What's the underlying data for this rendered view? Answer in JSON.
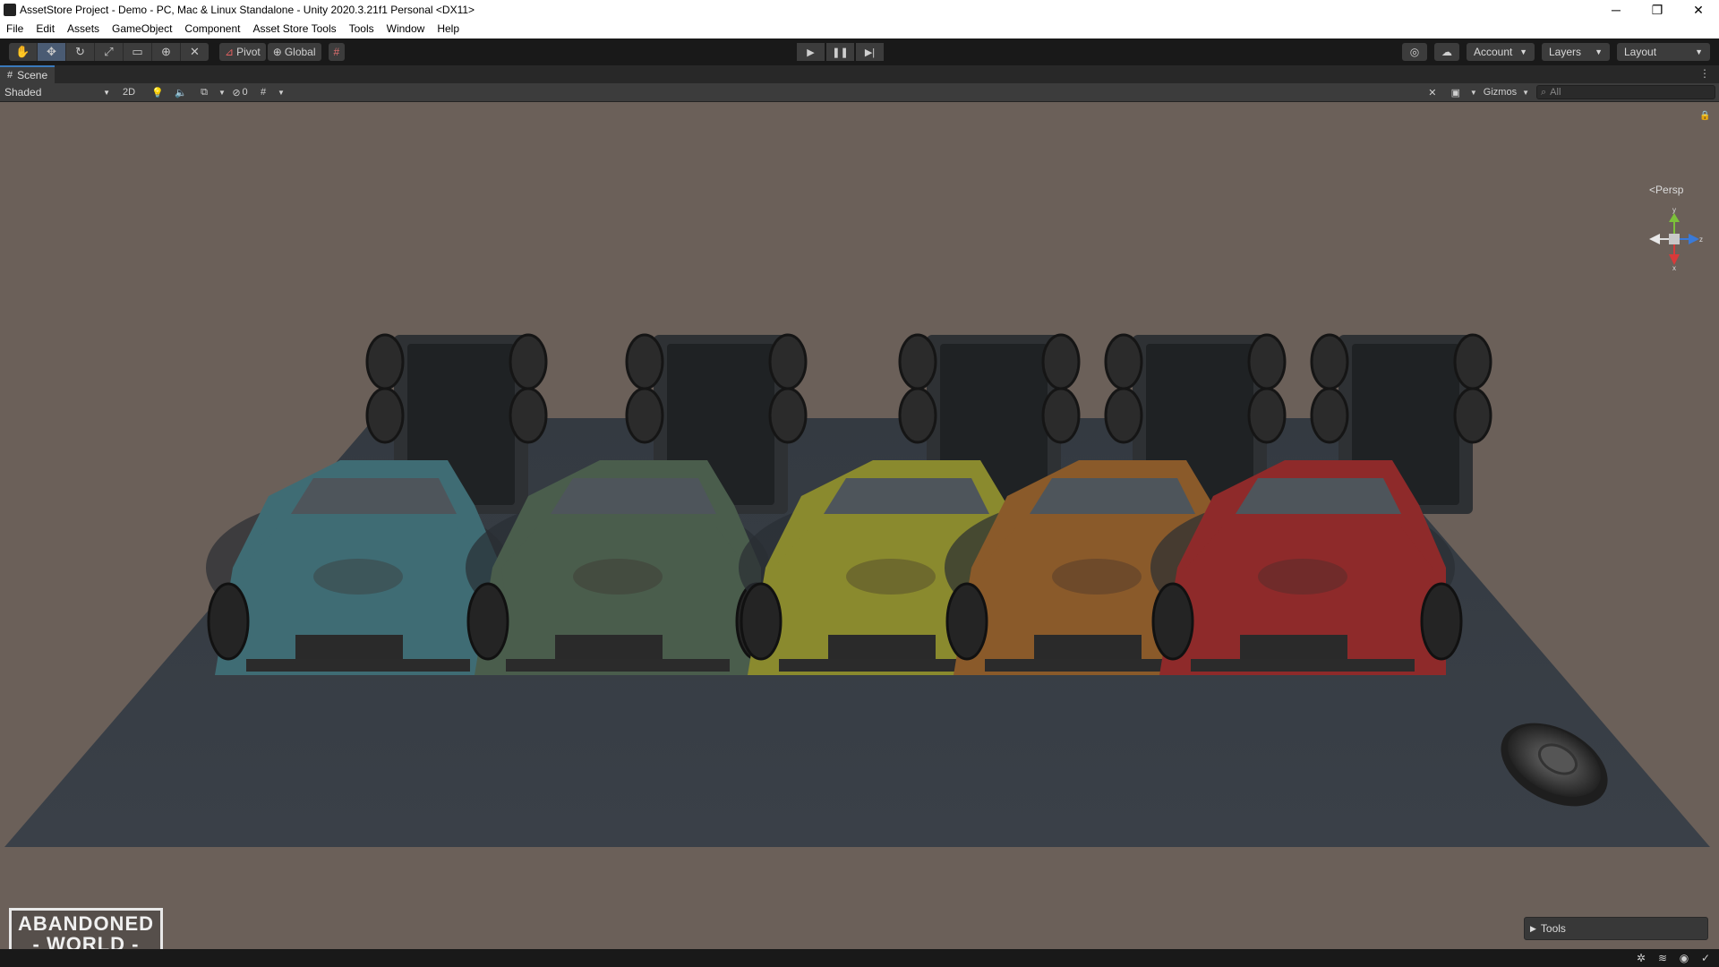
{
  "window": {
    "title": "AssetStore Project - Demo - PC, Mac & Linux Standalone - Unity 2020.3.21f1 Personal <DX11>",
    "minimize": "─",
    "restore": "❐",
    "close": "✕"
  },
  "menu": [
    "File",
    "Edit",
    "Assets",
    "GameObject",
    "Component",
    "Asset Store Tools",
    "Tools",
    "Window",
    "Help"
  ],
  "toolbar": {
    "pivot": "Pivot",
    "global": "Global",
    "account": "Account",
    "layers": "Layers",
    "layout": "Layout"
  },
  "scene": {
    "tab": "Scene",
    "shading": "Shaded",
    "mode_2d": "2D",
    "hidden_count": "0",
    "gizmos": "Gizmos",
    "search_placeholder": "All",
    "projection": "Persp",
    "axis_y": "y",
    "axis_z": "z",
    "axis_x": "x",
    "tools_panel": "Tools"
  },
  "overlay": {
    "logo_line1": "ABANDONED",
    "logo_line2": "WORLD"
  },
  "trucks": [
    {
      "color": "#3f6c74"
    },
    {
      "color": "#4a5d4c"
    },
    {
      "color": "#8a8a2e"
    },
    {
      "color": "#8a5a2a"
    },
    {
      "color": "#8e2a2a"
    }
  ]
}
